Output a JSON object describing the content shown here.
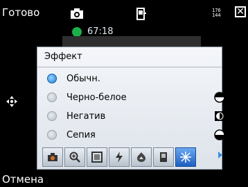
{
  "topbar": {
    "done_label": "Готово",
    "res_text_top": "176",
    "res_text_bottom": "144"
  },
  "recording": {
    "time": "67:18"
  },
  "panel": {
    "title": "Эффект",
    "options": [
      {
        "label": "Обычн.",
        "selected": true,
        "icon": "none"
      },
      {
        "label": "Черно-белое",
        "selected": false,
        "icon": "circle-half-bw-icon"
      },
      {
        "label": "Негатив",
        "selected": false,
        "icon": "negative-square-icon"
      },
      {
        "label": "Сепия",
        "selected": false,
        "icon": "circle-sepia-icon"
      }
    ]
  },
  "toolbar": {
    "buttons": [
      {
        "name": "camera-mode-icon",
        "active": false
      },
      {
        "name": "zoom-icon",
        "active": false
      },
      {
        "name": "frame-icon",
        "active": false
      },
      {
        "name": "flash-icon",
        "active": false
      },
      {
        "name": "white-balance-icon",
        "active": false
      },
      {
        "name": "brightness-icon",
        "active": false
      },
      {
        "name": "effect-star-icon",
        "active": true
      }
    ]
  },
  "bottombar": {
    "cancel_label": "Отмена"
  },
  "colors": {
    "rec_dot": "#1bb14a",
    "selected_radio": "#1a7fd8",
    "active_tool": "#1f5fc0"
  }
}
